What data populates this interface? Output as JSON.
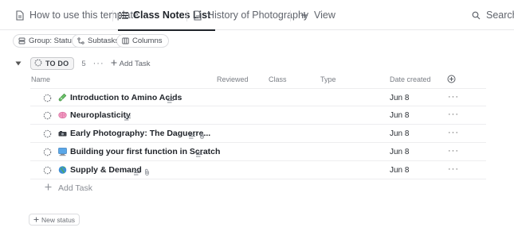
{
  "views": {
    "tabs": [
      {
        "label": "How to use this template",
        "icon": "document-icon"
      },
      {
        "label": "Class Notes List",
        "icon": "list-icon"
      },
      {
        "label": "History of Photography",
        "icon": "document-icon"
      }
    ],
    "add_view_label": "View",
    "search_label": "Search"
  },
  "filters": {
    "group_label": "Group: Status",
    "subtasks_label": "Subtasks",
    "columns_label": "Columns"
  },
  "group": {
    "status": "TO DO",
    "count": "5",
    "add_task_label": "Add Task"
  },
  "columns": {
    "name": "Name",
    "reviewed": "Reviewed",
    "class": "Class",
    "type": "Type",
    "date_created": "Date created"
  },
  "tasks": [
    {
      "name": "Introduction to Amino Acids",
      "emoji": "test-tube-icon",
      "date": "Jun 8",
      "has_description": true,
      "has_attachment": false
    },
    {
      "name": "Neuroplasticity",
      "emoji": "brain-icon",
      "date": "Jun 8",
      "has_description": true,
      "has_attachment": false
    },
    {
      "name": "Early Photography: The Daguerre...",
      "emoji": "camera-icon",
      "date": "Jun 8",
      "has_description": true,
      "has_attachment": true
    },
    {
      "name": "Building your first function in Scratch",
      "emoji": "computer-icon",
      "date": "Jun 8",
      "has_description": true,
      "has_attachment": false
    },
    {
      "name": "Supply & Demand",
      "emoji": "globe-icon",
      "date": "Jun 8",
      "has_description": true,
      "has_attachment": true
    }
  ],
  "add_task_row_label": "Add Task",
  "new_status_label": "New status",
  "colors": {
    "accent": "#1f2329",
    "border": "#e8e8ea",
    "muted_text": "#7a7e85"
  }
}
